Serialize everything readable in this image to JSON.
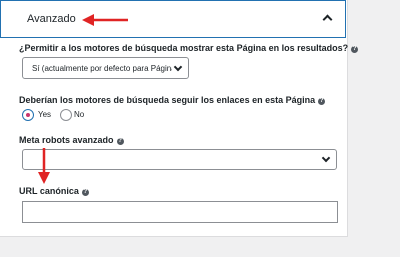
{
  "section": {
    "title": "Avanzado"
  },
  "fields": {
    "search_index": {
      "label": "¿Permitir a los motores de búsqueda mostrar esta Página en los resultados?",
      "help_icon": "question-circle-icon",
      "selected": "Sí (actualmente por defecto para Páginas)"
    },
    "follow_links": {
      "label": "Deberían los motores de búsqueda seguir los enlaces en esta Página",
      "help_icon": "question-circle-icon",
      "options": [
        {
          "label": "Yes",
          "checked": true
        },
        {
          "label": "No",
          "checked": false
        }
      ]
    },
    "meta_robots": {
      "label": "Meta robots avanzado",
      "help_icon": "question-circle-icon",
      "selected": ""
    },
    "canonical": {
      "label": "URL canónica",
      "help_icon": "question-circle-icon",
      "value": ""
    }
  },
  "annotations": {
    "arrow_color": "#e02424"
  },
  "colors": {
    "accent": "#2271b1",
    "radio_selected": "#c9356e"
  }
}
